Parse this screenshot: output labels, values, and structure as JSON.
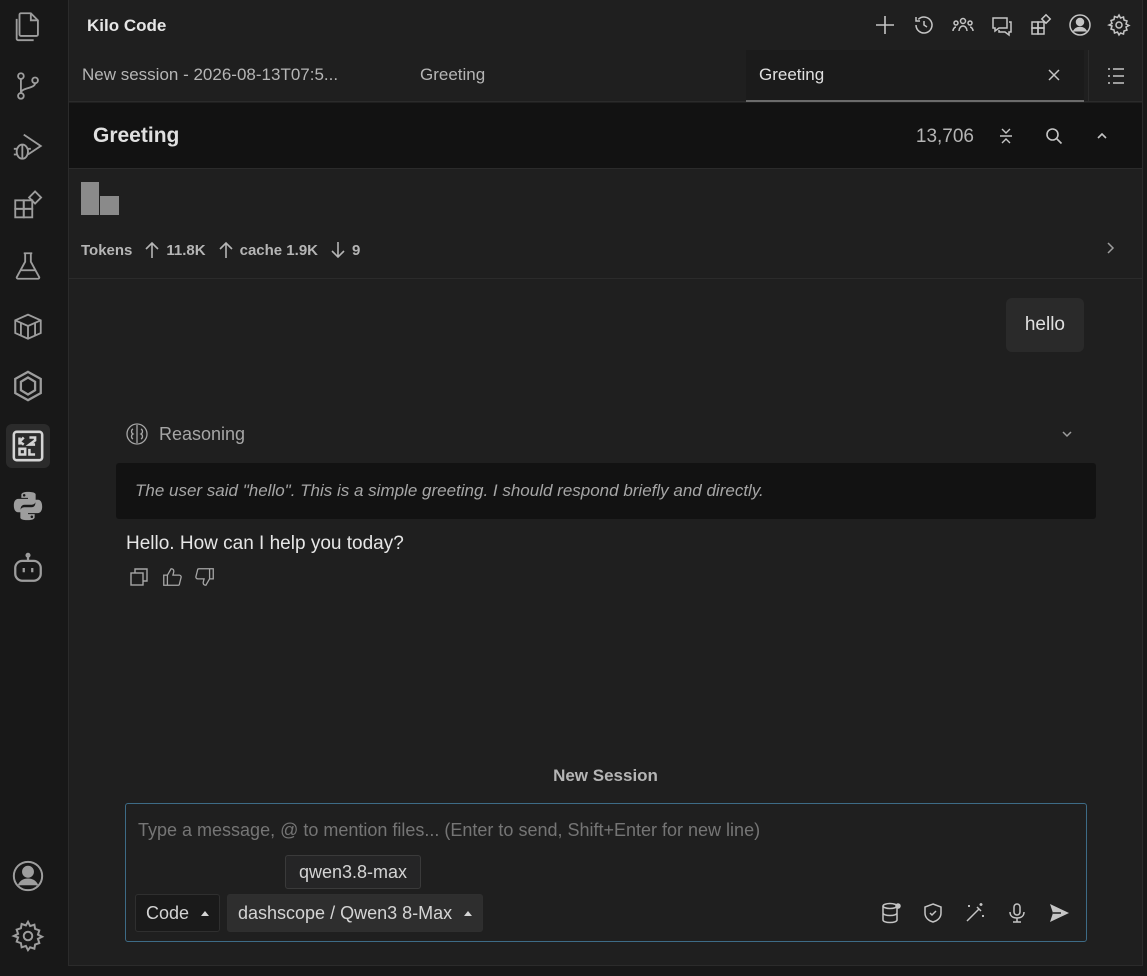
{
  "activity_bar": {
    "items": [
      {
        "icon": "explorer-icon"
      },
      {
        "icon": "source-control-icon"
      },
      {
        "icon": "run-debug-icon"
      },
      {
        "icon": "extensions-icon"
      },
      {
        "icon": "testing-icon"
      },
      {
        "icon": "containers-icon"
      },
      {
        "icon": "hexagon-icon"
      },
      {
        "icon": "kilo-code-icon",
        "active": true
      },
      {
        "icon": "python-icon"
      },
      {
        "icon": "robot-icon"
      }
    ],
    "bottom": [
      {
        "icon": "accounts-icon"
      },
      {
        "icon": "manage-gear-icon"
      }
    ]
  },
  "header": {
    "title": "Kilo Code",
    "actions": [
      "new-task-icon",
      "history-icon",
      "agents-icon",
      "chat-icon",
      "marketplace-icon",
      "profile-icon",
      "settings-icon"
    ]
  },
  "tabs": [
    {
      "label": "New session - 2026-08-13T07:5..."
    },
    {
      "label": "Greeting"
    },
    {
      "label": "Greeting",
      "active": true
    }
  ],
  "task": {
    "title": "Greeting",
    "count": "13,706"
  },
  "tokens": {
    "label": "Tokens",
    "up": "11.8K",
    "cache": "cache 1.9K",
    "down": "9"
  },
  "messages": {
    "user": "hello",
    "reasoning_label": "Reasoning",
    "reasoning_text": "The user said \"hello\". This is a simple greeting. I should respond briefly and directly.",
    "assistant": "Hello. How can I help you today?"
  },
  "footer": {
    "new_session": "New Session"
  },
  "composer": {
    "placeholder": "Type a message, @ to mention files... (Enter to send, Shift+Enter for new line)",
    "tooltip": "qwen3.8-max",
    "mode": "Code",
    "model": "dashscope / Qwen3 8-Max"
  },
  "colors": {
    "background": "#1f1f1f",
    "accent_border": "#3d6b86"
  }
}
